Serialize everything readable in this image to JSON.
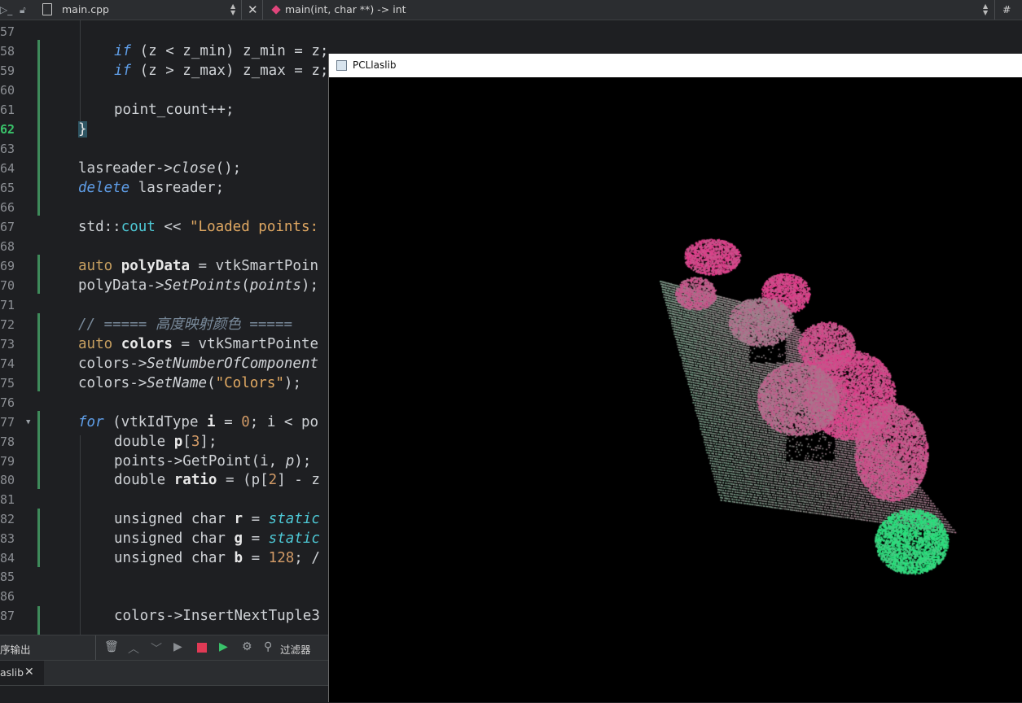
{
  "topbar": {
    "file_name": "main.cpp",
    "function_signature": "main(int, char **) -> int",
    "hash": "#"
  },
  "editor": {
    "lines": [
      {
        "n": "57",
        "text": ""
      },
      {
        "n": "58",
        "text": "if_zmin"
      },
      {
        "n": "59",
        "text": "if_zmax"
      },
      {
        "n": "60",
        "text": ""
      },
      {
        "n": "61",
        "text": "point_count++;"
      },
      {
        "n": "62",
        "text": "}"
      },
      {
        "n": "63",
        "text": ""
      },
      {
        "n": "64",
        "text": "lasreader_close"
      },
      {
        "n": "65",
        "text": "delete_lasreader"
      },
      {
        "n": "66",
        "text": ""
      },
      {
        "n": "67",
        "text": "cout"
      },
      {
        "n": "68",
        "text": ""
      },
      {
        "n": "69",
        "text": "polydata"
      },
      {
        "n": "70",
        "text": "setpoints"
      },
      {
        "n": "71",
        "text": ""
      },
      {
        "n": "72",
        "text": "comment"
      },
      {
        "n": "73",
        "text": "colors"
      },
      {
        "n": "74",
        "text": "setnum"
      },
      {
        "n": "75",
        "text": "setname"
      },
      {
        "n": "76",
        "text": ""
      },
      {
        "n": "77",
        "text": "for"
      },
      {
        "n": "78",
        "text": "double_p"
      },
      {
        "n": "79",
        "text": "getpoint"
      },
      {
        "n": "80",
        "text": "ratio"
      },
      {
        "n": "81",
        "text": ""
      },
      {
        "n": "82",
        "text": "r"
      },
      {
        "n": "83",
        "text": "g"
      },
      {
        "n": "84",
        "text": "b"
      },
      {
        "n": "85",
        "text": ""
      },
      {
        "n": "86",
        "text": ""
      },
      {
        "n": "87",
        "text": "insert"
      }
    ],
    "code": {
      "l58_kw": "if",
      "l58_rest": " (z < z_min) z_min = z;",
      "l59_kw": "if",
      "l59_rest": " (z > z_max) z_max = z;",
      "l61": "point_count++;",
      "l62": "}",
      "l64_a": "lasreader->",
      "l64_fn": "close",
      "l64_b": "();",
      "l65_kw": "delete",
      "l65_rest": " lasreader;",
      "l67_a": "std::",
      "l67_cout": "cout",
      "l67_b": " << ",
      "l67_str": "\"Loaded points: ",
      "l69_kw": "auto",
      "l69_var": " polyData",
      "l69_rest": " = vtkSmartPoin",
      "l70_a": "polyData->",
      "l70_fn": "SetPoints",
      "l70_b": "(",
      "l70_arg": "points",
      "l70_c": ");",
      "l72": "// ===== 高度映射颜色 =====",
      "l73_kw": "auto",
      "l73_var": " colors",
      "l73_rest": " = vtkSmartPointe",
      "l74_a": "colors->",
      "l74_fn": "SetNumberOfComponent",
      "l75_a": "colors->",
      "l75_fn": "SetName",
      "l75_b": "(",
      "l75_str": "\"Colors\"",
      "l75_c": ");",
      "l77_kw": "for",
      "l77_a": " (vtkIdType ",
      "l77_var": "i",
      "l77_b": " = ",
      "l77_num": "0",
      "l77_c": "; i < po",
      "l78_a": "double ",
      "l78_var": "p",
      "l78_b": "[",
      "l78_num": "3",
      "l78_c": "];",
      "l79_a": "points->GetPoint(i, ",
      "l79_arg": "p",
      "l79_b": ");",
      "l80_a": "double ",
      "l80_var": "ratio",
      "l80_b": " = (p[",
      "l80_num": "2",
      "l80_c": "] - z",
      "l82_a": "unsigned char ",
      "l82_var": "r",
      "l82_b": " = ",
      "l82_it": "static",
      "l83_a": "unsigned char ",
      "l83_var": "g",
      "l83_b": " = ",
      "l83_it": "static",
      "l84_a": "unsigned char ",
      "l84_var": "b",
      "l84_b": " = ",
      "l84_num": "128",
      "l84_c": "; /",
      "l87": "colors->InsertNextTuple3"
    }
  },
  "panel": {
    "output_label": "序输出",
    "filter_label": "过滤器",
    "tab_label": "aslib"
  },
  "viewer": {
    "title": "PCLlaslib",
    "colors": {
      "background": "#000000",
      "high": "#e8338a",
      "low": "#1ee87a",
      "mid": "#7aa88e"
    }
  }
}
